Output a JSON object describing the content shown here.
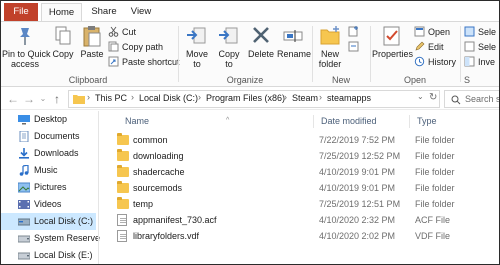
{
  "tabs": [
    "File",
    "Home",
    "Share",
    "View"
  ],
  "ribbon": {
    "clipboard": {
      "label": "Clipboard",
      "pin_label": "Pin to Quick\naccess",
      "copy_label": "Copy",
      "paste_label": "Paste",
      "cut_label": "Cut",
      "copy_path_label": "Copy path",
      "paste_shortcut_label": "Paste shortcut"
    },
    "organize": {
      "label": "Organize",
      "move_to_label": "Move\nto",
      "copy_to_label": "Copy\nto",
      "delete_label": "Delete",
      "rename_label": "Rename"
    },
    "new": {
      "label": "New",
      "new_folder_label": "New\nfolder"
    },
    "open": {
      "label": "Open",
      "properties_label": "Properties",
      "open_label": "Open",
      "edit_label": "Edit",
      "history_label": "History"
    },
    "select": {
      "label": "S",
      "select_all_label": "Sele",
      "select_none_label": "Sele",
      "invert_label": "Inve"
    }
  },
  "address": {
    "crumbs": [
      "This PC",
      "Local Disk (C:)",
      "Program Files (x86)",
      "Steam",
      "steamapps"
    ],
    "search_placeholder": "Search stea"
  },
  "nav": {
    "items": [
      {
        "label": "Desktop",
        "icon": "desktop-icon"
      },
      {
        "label": "Documents",
        "icon": "documents-icon"
      },
      {
        "label": "Downloads",
        "icon": "downloads-icon"
      },
      {
        "label": "Music",
        "icon": "music-icon"
      },
      {
        "label": "Pictures",
        "icon": "pictures-icon"
      },
      {
        "label": "Videos",
        "icon": "videos-icon"
      },
      {
        "label": "Local Disk (C:)",
        "icon": "drive-icon",
        "selected": true
      },
      {
        "label": "System Reserve",
        "icon": "drive-icon"
      },
      {
        "label": "Local Disk (E:)",
        "icon": "drive-icon"
      }
    ]
  },
  "list": {
    "columns": [
      "Name",
      "Date modified",
      "Type"
    ],
    "rows": [
      {
        "name": "common",
        "date": "7/22/2019 7:52 PM",
        "type": "File folder",
        "kind": "folder"
      },
      {
        "name": "downloading",
        "date": "7/25/2019 12:52 PM",
        "type": "File folder",
        "kind": "folder"
      },
      {
        "name": "shadercache",
        "date": "4/10/2019 9:01 PM",
        "type": "File folder",
        "kind": "folder"
      },
      {
        "name": "sourcemods",
        "date": "4/10/2019 9:01 PM",
        "type": "File folder",
        "kind": "folder"
      },
      {
        "name": "temp",
        "date": "7/25/2019 12:51 PM",
        "type": "File folder",
        "kind": "folder"
      },
      {
        "name": "appmanifest_730.acf",
        "date": "4/10/2020 2:32 PM",
        "type": "ACF File",
        "kind": "file"
      },
      {
        "name": "libraryfolders.vdf",
        "date": "4/10/2020 2:02 PM",
        "type": "VDF File",
        "kind": "file"
      }
    ]
  },
  "colors": {
    "file_tab": "#c1412a",
    "selected_nav": "#cce8ff",
    "folder": "#f6c64f",
    "header_text": "#4c607a"
  }
}
